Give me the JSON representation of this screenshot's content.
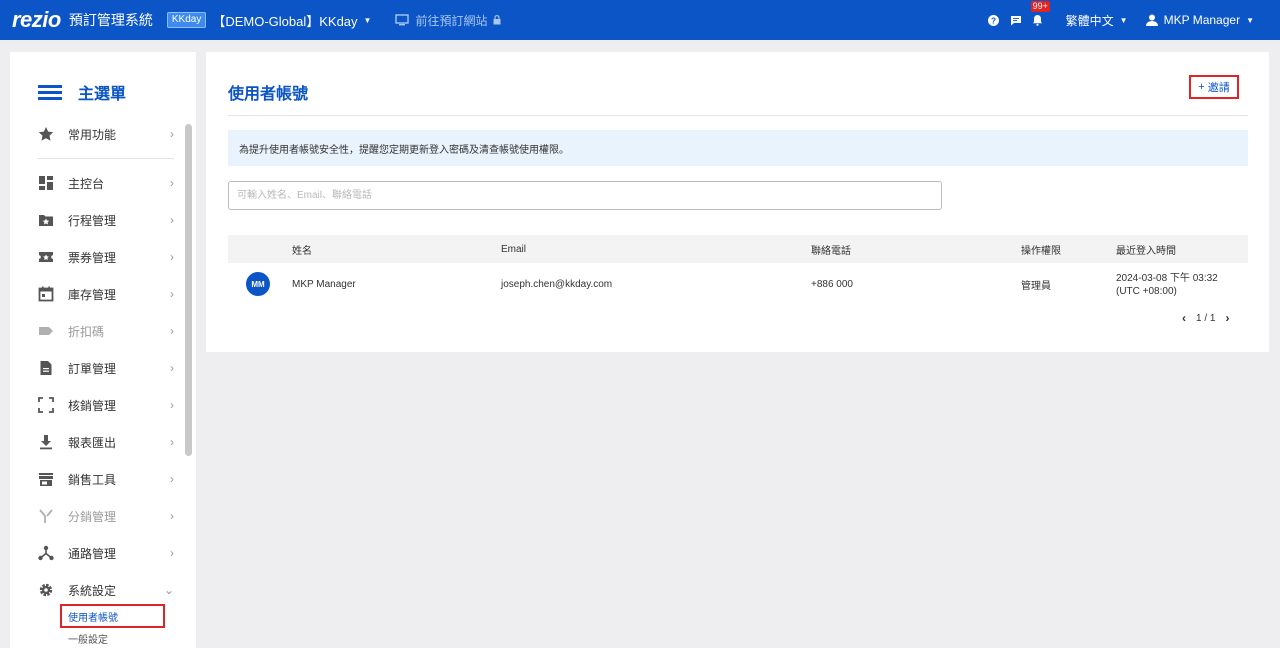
{
  "topbar": {
    "logo": "rezio",
    "system_title": "預訂管理系統",
    "brand_badge": "KKday",
    "account": "【DEMO-Global】KKday",
    "goto_site": "前往預訂網站",
    "notification_count": "99+",
    "language": "繁體中文",
    "user": "MKP Manager",
    "bar_color": "#0b55c6"
  },
  "sidebar": {
    "title": "主選單",
    "items": [
      {
        "label": "常用功能",
        "icon": "star-icon"
      },
      {
        "label": "主控台",
        "icon": "dashboard-icon"
      },
      {
        "label": "行程管理",
        "icon": "folder-star-icon"
      },
      {
        "label": "票券管理",
        "icon": "ticket-icon"
      },
      {
        "label": "庫存管理",
        "icon": "calendar-icon"
      },
      {
        "label": "折扣碼",
        "icon": "tag-icon"
      },
      {
        "label": "訂單管理",
        "icon": "document-icon"
      },
      {
        "label": "核銷管理",
        "icon": "scan-icon"
      },
      {
        "label": "報表匯出",
        "icon": "download-icon"
      },
      {
        "label": "銷售工具",
        "icon": "store-icon"
      },
      {
        "label": "分銷管理",
        "icon": "split-icon"
      },
      {
        "label": "通路管理",
        "icon": "network-icon"
      },
      {
        "label": "系統設定",
        "icon": "gear-icon"
      }
    ],
    "sub_items": [
      "使用者帳號",
      "一般設定"
    ]
  },
  "main": {
    "title": "使用者帳號",
    "invite_label": "邀請",
    "info": "為提升使用者帳號安全性，提醒您定期更新登入密碼及清查帳號使用權限。",
    "search_placeholder": "可輸入姓名、Email、聯絡電話",
    "columns": [
      "姓名",
      "Email",
      "聯絡電話",
      "操作權限",
      "最近登入時間"
    ],
    "rows": [
      {
        "initials": "MM",
        "name": "MKP Manager",
        "email": "joseph.chen@kkday.com",
        "phone": "+886 000",
        "role": "管理員",
        "last_login_date": "2024-03-08 下午 03:32",
        "last_login_tz": "(UTC +08:00)"
      }
    ],
    "pagination": "1 / 1"
  },
  "colors": {
    "accent": "#0b55c6",
    "highlight": "#e02323",
    "info_bg": "#e8f3fd"
  }
}
